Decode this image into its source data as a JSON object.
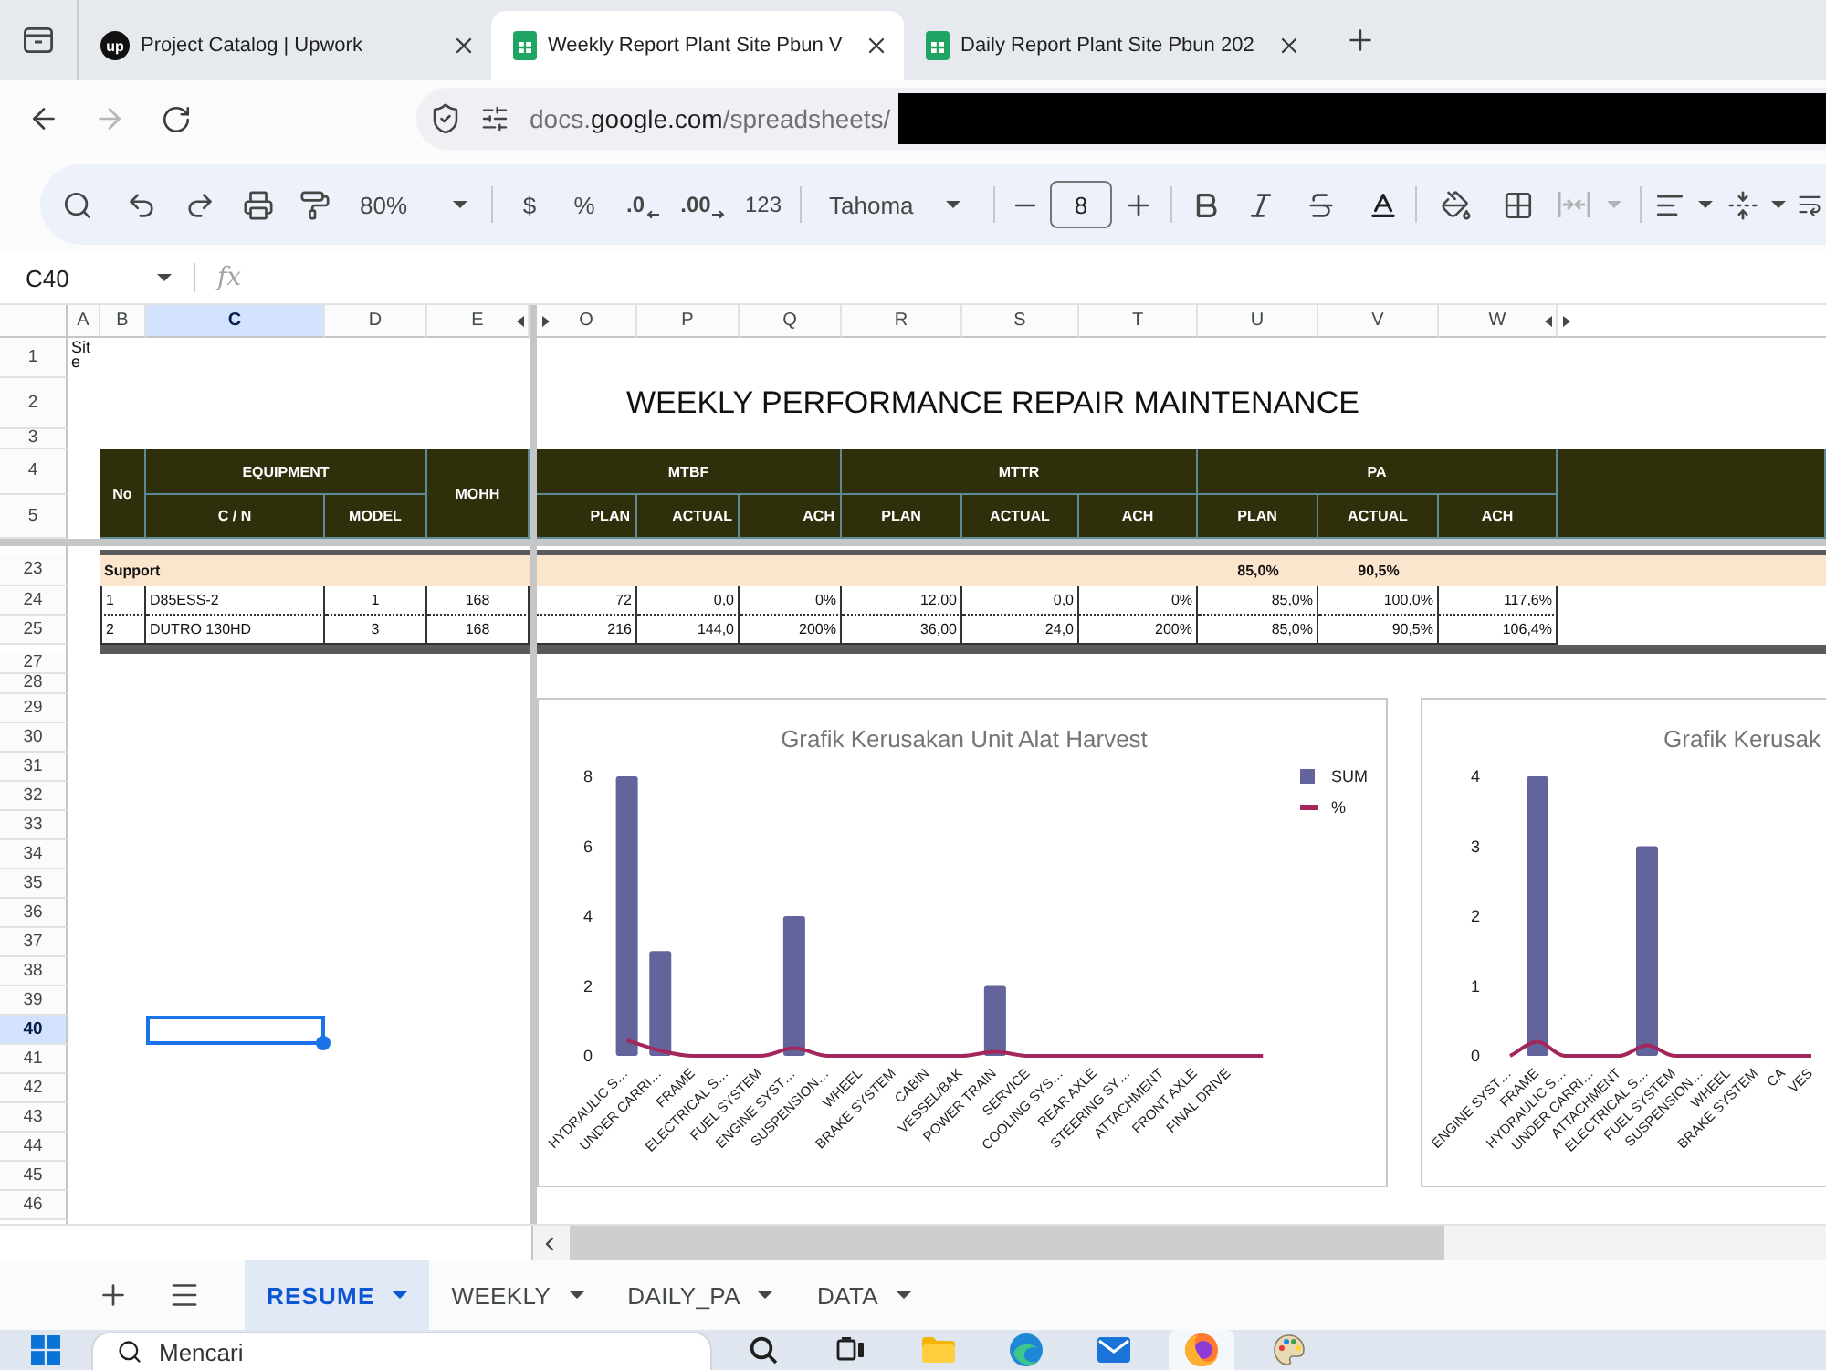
{
  "browser": {
    "tabs": [
      {
        "title": "Project Catalog | Upwork",
        "kind": "brand",
        "favicon_text": "up",
        "selected": false
      },
      {
        "title": "Weekly Report Plant Site Pbun V",
        "kind": "sheets",
        "selected": true
      },
      {
        "title": "Daily Report Plant Site Pbun 202",
        "kind": "sheets",
        "selected": false
      }
    ],
    "navigation": {
      "back_disabled": false,
      "forward_disabled": true
    },
    "address": {
      "url": "docs.**google.com**/spreadsheets/"
    }
  },
  "toolbar": {
    "zoom": "80%",
    "currency": "$",
    "percent": "%",
    "decrease_decimal": ".0",
    "increase_decimal": ".00",
    "number_format": "123",
    "font": "Tahoma",
    "font_size": "8",
    "merge_disabled": true
  },
  "formula_bar": {
    "name_box": "C40",
    "function_label": "fx"
  },
  "sheet": {
    "column_headers": [
      {
        "label": "A",
        "selected": false
      },
      {
        "label": "B",
        "selected": false
      },
      {
        "label": "C",
        "selected": true
      },
      {
        "label": "D",
        "selected": false
      },
      {
        "label": "E",
        "selected": false
      },
      {
        "label": "O",
        "selected": false
      },
      {
        "label": "P",
        "selected": false
      },
      {
        "label": "Q",
        "selected": false
      },
      {
        "label": "R",
        "selected": false
      },
      {
        "label": "S",
        "selected": false
      },
      {
        "label": "T",
        "selected": false
      },
      {
        "label": "U",
        "selected": false
      },
      {
        "label": "V",
        "selected": false
      },
      {
        "label": "W",
        "selected": false
      }
    ],
    "row_headers": [
      {
        "label": "1",
        "selected": false
      },
      {
        "label": "2",
        "selected": false
      },
      {
        "label": "3",
        "selected": false
      },
      {
        "label": "4",
        "selected": false
      },
      {
        "label": "5",
        "selected": false
      },
      {
        "label": "23",
        "selected": false
      },
      {
        "label": "24",
        "selected": false
      },
      {
        "label": "25",
        "selected": false
      },
      {
        "label": "27",
        "selected": false
      },
      {
        "label": "28",
        "selected": false
      },
      {
        "label": "29",
        "selected": false
      },
      {
        "label": "30",
        "selected": false
      },
      {
        "label": "31",
        "selected": false
      },
      {
        "label": "32",
        "selected": false
      },
      {
        "label": "33",
        "selected": false
      },
      {
        "label": "34",
        "selected": false
      },
      {
        "label": "35",
        "selected": false
      },
      {
        "label": "36",
        "selected": false
      },
      {
        "label": "37",
        "selected": false
      },
      {
        "label": "38",
        "selected": false
      },
      {
        "label": "39",
        "selected": false
      },
      {
        "label": "40",
        "selected": true
      },
      {
        "label": "41",
        "selected": false
      },
      {
        "label": "42",
        "selected": false
      },
      {
        "label": "43",
        "selected": false
      },
      {
        "label": "44",
        "selected": false
      },
      {
        "label": "45",
        "selected": false
      },
      {
        "label": "46",
        "selected": false
      }
    ],
    "site_label": "Site",
    "title": "WEEKLY PERFORMANCE REPAIR MAINTENANCE",
    "table": {
      "header": {
        "no": "No",
        "equipment": "EQUIPMENT",
        "cn": "C / N",
        "model": "MODEL",
        "mohh": "MOHH",
        "groups": [
          {
            "label": "MTBF",
            "columns": [
              "PLAN",
              "ACTUAL",
              "ACH"
            ]
          },
          {
            "label": "MTTR",
            "columns": [
              "PLAN",
              "ACTUAL",
              "ACH"
            ]
          },
          {
            "label": "PA",
            "columns": [
              "PLAN",
              "ACTUAL",
              "ACH"
            ]
          }
        ]
      },
      "group_row": {
        "label": "Support",
        "pa_plan": "85,0%",
        "pa_actual": "90,5%"
      },
      "rows": [
        {
          "no": "1",
          "cn": "D85ESS-2",
          "model": "1",
          "mohh": "168",
          "values": [
            "72",
            "0,0",
            "0%",
            "12,00",
            "0,0",
            "0%",
            "85,0%",
            "100,0%",
            "117,6%"
          ]
        },
        {
          "no": "2",
          "cn": "DUTRO 130HD",
          "model": "3",
          "mohh": "168",
          "values": [
            "216",
            "144,0",
            "200%",
            "36,00",
            "24,0",
            "200%",
            "85,0%",
            "90,5%",
            "106,4%"
          ]
        }
      ]
    },
    "charts": [
      {
        "chart_data": {
          "type": "bar",
          "title": "Grafik Kerusakan Unit Alat Harvest",
          "categories": [
            "HYDRAULIC S…",
            "UNDER CARRI…",
            "FRAME",
            "ELECTRICAL S…",
            "FUEL SYSTEM",
            "ENGINE SYST…",
            "SUSPENSION…",
            "WHEEL",
            "BRAKE SYSTEM",
            "CABIN",
            "VESSEL/BAK",
            "POWER TRAIN",
            "SERVICE",
            "COOLING SYS…",
            "REAR AXLE",
            "STEERING SY…",
            "ATTACHMENT",
            "FRONT AXLE",
            "FINAL DRIVE",
            null
          ],
          "series": [
            {
              "name": "SUM",
              "type": "bar",
              "color": "#62649b",
              "values": [
                8,
                3,
                0,
                0,
                0,
                4,
                0,
                0,
                0,
                0,
                0,
                2,
                0,
                0,
                0,
                0,
                0,
                0,
                0,
                0
              ]
            },
            {
              "name": "%",
              "type": "line",
              "color": "#a3275d",
              "values": [
                0.45,
                0.15,
                0,
                0,
                0,
                0.22,
                0,
                0,
                0,
                0,
                0,
                0.12,
                0,
                0,
                0,
                0,
                0,
                0,
                0,
                0
              ]
            }
          ],
          "ylim": [
            0,
            8
          ],
          "yticks": [
            0,
            2,
            4,
            6,
            8
          ],
          "legend": "right"
        }
      },
      {
        "chart_data": {
          "type": "bar",
          "title": "Grafik Kerusak",
          "categories": [
            "ENGINE SYST…",
            "FRAME",
            "HYDRAULIC S…",
            "UNDER CARRI…",
            "ATTACHMENT",
            "ELECTRICAL S…",
            "FUEL SYSTEM",
            "SUSPENSION…",
            "WHEEL",
            "BRAKE SYSTEM",
            "CA",
            "VES"
          ],
          "series": [
            {
              "type": "bar",
              "color": "#62649b",
              "values": [
                0,
                4,
                0,
                0,
                0,
                3,
                0,
                0,
                0,
                0,
                0,
                0
              ]
            },
            {
              "type": "line",
              "color": "#a3275d",
              "values": [
                0,
                0.2,
                0,
                0,
                0,
                0.15,
                0,
                0,
                0,
                0,
                0,
                0
              ]
            }
          ],
          "ylim": [
            0,
            4
          ],
          "yticks": [
            0,
            1,
            2,
            3,
            4
          ]
        }
      }
    ]
  },
  "sheet_tabs": [
    {
      "label": "RESUME",
      "selected": true
    },
    {
      "label": "WEEKLY",
      "selected": false
    },
    {
      "label": "DAILY_PA",
      "selected": false
    },
    {
      "label": "DATA",
      "selected": false
    }
  ],
  "taskbar": {
    "search": {
      "placeholder": "Mencari"
    },
    "apps": [
      {
        "kind": "search",
        "active": false
      },
      {
        "kind": "taskview",
        "active": false
      },
      {
        "kind": "folder",
        "active": false
      },
      {
        "kind": "wave",
        "active": false
      },
      {
        "kind": "mail",
        "active": false
      },
      {
        "kind": "fox",
        "active": true
      },
      {
        "kind": "palette",
        "active": false
      }
    ]
  }
}
